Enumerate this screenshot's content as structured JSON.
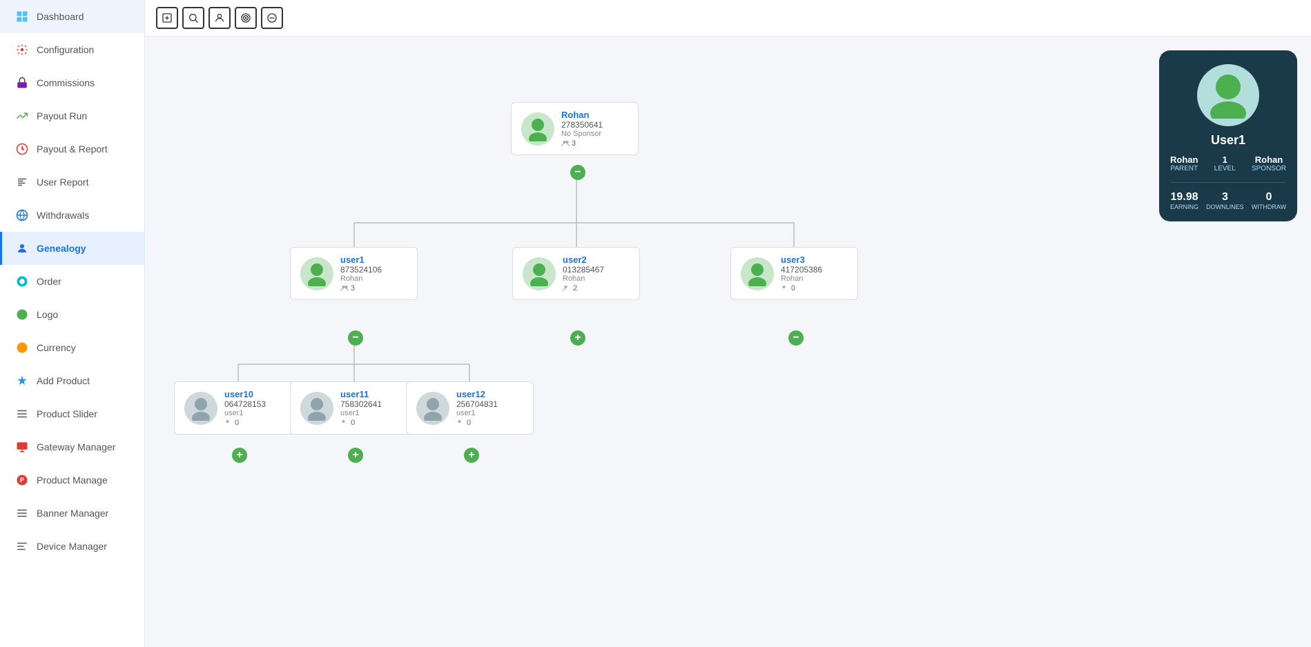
{
  "sidebar": {
    "items": [
      {
        "id": "dashboard",
        "label": "Dashboard",
        "icon": "🖥",
        "active": false
      },
      {
        "id": "configuration",
        "label": "Configuration",
        "icon": "⚙",
        "active": false
      },
      {
        "id": "commissions",
        "label": "Commissions",
        "icon": "🔒",
        "active": false
      },
      {
        "id": "payout-run",
        "label": "Payout Run",
        "icon": "📈",
        "active": false
      },
      {
        "id": "payout-report",
        "label": "Payout & Report",
        "icon": "📊",
        "active": false
      },
      {
        "id": "user-report",
        "label": "User Report",
        "icon": "📋",
        "active": false
      },
      {
        "id": "withdrawals",
        "label": "Withdrawals",
        "icon": "🌐",
        "active": false
      },
      {
        "id": "genealogy",
        "label": "Genealogy",
        "icon": "👤",
        "active": true
      },
      {
        "id": "order",
        "label": "Order",
        "icon": "💎",
        "active": false
      },
      {
        "id": "logo",
        "label": "Logo",
        "icon": "🟢",
        "active": false
      },
      {
        "id": "currency",
        "label": "Currency",
        "icon": "🟠",
        "active": false
      },
      {
        "id": "add-product",
        "label": "Add Product",
        "icon": "⬆",
        "active": false
      },
      {
        "id": "product-slider",
        "label": "Product Slider",
        "icon": "≡",
        "active": false
      },
      {
        "id": "gateway-manager",
        "label": "Gateway Manager",
        "icon": "🖥",
        "active": false
      },
      {
        "id": "product-manage",
        "label": "Product Manage",
        "icon": "🅟",
        "active": false
      },
      {
        "id": "banner-manager",
        "label": "Banner Manager",
        "icon": "≡",
        "active": false
      },
      {
        "id": "device-manager",
        "label": "Device Manager",
        "icon": "≡",
        "active": false
      }
    ]
  },
  "toolbar": {
    "buttons": [
      {
        "id": "add",
        "icon": "⊞",
        "label": "Add"
      },
      {
        "id": "search",
        "icon": "🔍",
        "label": "Search"
      },
      {
        "id": "user",
        "icon": "👤",
        "label": "User"
      },
      {
        "id": "target",
        "icon": "◎",
        "label": "Target"
      },
      {
        "id": "minus-circle",
        "icon": "⊖",
        "label": "Minus Circle"
      }
    ]
  },
  "tree": {
    "root": {
      "name": "Rohan",
      "id": "278350641",
      "sponsor": "No Sponsor",
      "count": 3,
      "toggle": "-",
      "avatar_green": true
    },
    "level1": [
      {
        "name": "user1",
        "id": "873524106",
        "sponsor": "Rohan",
        "count": 3,
        "toggle": "-",
        "avatar_green": true
      },
      {
        "name": "user2",
        "id": "013285467",
        "sponsor": "Rohan",
        "count": 2,
        "toggle": "+",
        "avatar_green": true
      },
      {
        "name": "user3",
        "id": "417205386",
        "sponsor": "Rohan",
        "count": 0,
        "toggle": "-",
        "avatar_green": true
      }
    ],
    "level2": [
      {
        "name": "user10",
        "id": "064728153",
        "sponsor": "user1",
        "count": 0,
        "toggle": "+",
        "avatar_green": false
      },
      {
        "name": "user11",
        "id": "758302641",
        "sponsor": "user1",
        "count": 0,
        "toggle": "+",
        "avatar_green": false
      },
      {
        "name": "user12",
        "id": "256704831",
        "sponsor": "user1",
        "count": 0,
        "toggle": "+",
        "avatar_green": false
      }
    ]
  },
  "info_panel": {
    "name": "User1",
    "parent_label": "Parent",
    "parent_value": "Rohan",
    "level_label": "LEVEL",
    "level_value": "1",
    "sponsor_label": "Sponsor",
    "sponsor_value": "Rohan",
    "earning_label": "EARNING",
    "earning_value": "19.98",
    "downlines_label": "DOWNLINES",
    "downlines_value": "3",
    "withdraw_label": "WITHDRAW",
    "withdraw_value": "0"
  }
}
